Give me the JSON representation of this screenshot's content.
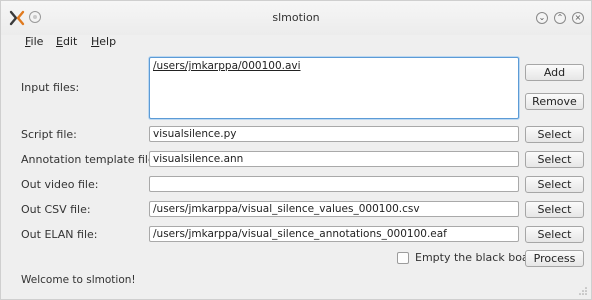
{
  "window": {
    "title": "slmotion"
  },
  "menu": {
    "file": {
      "u": "F",
      "rest": "ile"
    },
    "edit": {
      "u": "E",
      "rest": "dit"
    },
    "help": {
      "u": "H",
      "rest": "elp"
    }
  },
  "form": {
    "input_files_label": "Input files:",
    "input_files_value": "/users/jmkarppa/000100.avi",
    "script_label": "Script file:",
    "script_value": "visualsilence.py",
    "annotation_label": "Annotation template file:",
    "annotation_value": "visualsilence.ann",
    "out_video_label": "Out video file:",
    "out_video_value": "",
    "out_csv_label": "Out CSV file:",
    "out_csv_value": "/users/jmkarppa/visual_silence_values_000100.csv",
    "out_elan_label": "Out ELAN file:",
    "out_elan_value": "/users/jmkarppa/visual_silence_annotations_000100.eaf"
  },
  "buttons": {
    "add": "Add",
    "remove": "Remove",
    "select": "Select",
    "process": "Process"
  },
  "checkbox": {
    "label": "Empty the black board",
    "checked": false
  },
  "status": {
    "text": "Welcome to slmotion!"
  },
  "icons": {
    "app": "slmotion-app-icon",
    "minimize": "minimize-icon",
    "maximize": "maximize-icon",
    "close": "close-icon"
  }
}
